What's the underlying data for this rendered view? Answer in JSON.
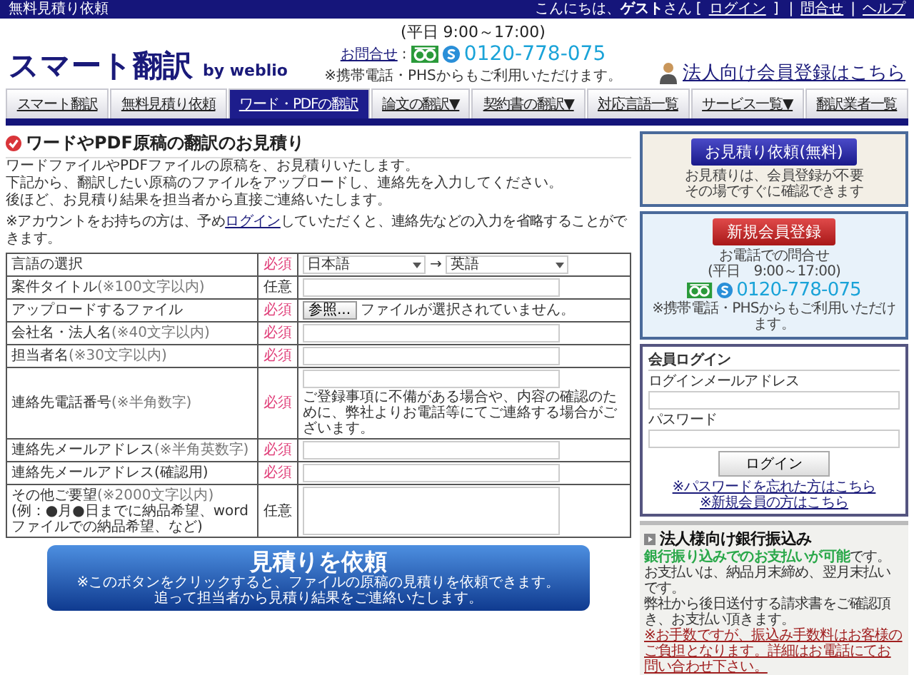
{
  "top_bar": {
    "left_link": "無料見積り依頼",
    "items": [
      {
        "kind": "text",
        "text": "こんにちは、**ゲスト**さん ["
      },
      {
        "kind": "link",
        "text": "ログイン"
      },
      {
        "kind": "text",
        "text": "]"
      },
      {
        "kind": "sep",
        "text": "|"
      },
      {
        "kind": "link",
        "text": "問合せ"
      },
      {
        "kind": "sep",
        "text": "|"
      },
      {
        "kind": "link",
        "text": "ヘルプ"
      }
    ]
  },
  "header": {
    "logo": "スマート翻訳",
    "logo_by": "by weblio",
    "hours": "(平日 9:00～17:00)",
    "contact_label": "お問合せ",
    "colon": ":",
    "phone": "0120-778-075",
    "phone_note": "※携帯電話・PHSからもご利用いただけます。",
    "corporate_link": "法人向け会員登録はこちら"
  },
  "nav": [
    {
      "label": "スマート翻訳",
      "selected": false
    },
    {
      "label": "無料見積り依頼",
      "selected": false
    },
    {
      "label": "ワード・PDFの翻訳",
      "selected": true
    },
    {
      "label": "論文の翻訳▼",
      "selected": false
    },
    {
      "label": "契約書の翻訳▼",
      "selected": false
    },
    {
      "label": "対応言語一覧",
      "selected": false
    },
    {
      "label": "サービス一覧▼",
      "selected": false
    },
    {
      "label": "翻訳業者一覧",
      "selected": false
    }
  ],
  "main": {
    "title": "ワードやPDF原稿の翻訳のお見積り",
    "intro": [
      "ワードファイルやPDFファイルの原稿を、お見積りいたします。",
      "下記から、翻訳したい原稿のファイルをアップロードし、連絡先を入力してください。",
      "後ほど、お見積り結果を担当者から直接ご連絡いたします。"
    ],
    "account_note": {
      "before": "※アカウントをお持ちの方は、予め",
      "link": "ログイン",
      "after": "していただくと、連絡先などの入力を省略することができます。"
    },
    "form_rows": [
      {
        "kind": "select",
        "label": "言語の選択",
        "required": true,
        "requirement": "必須",
        "from": "日本語",
        "arrow": "→",
        "to": "英語"
      },
      {
        "kind": "text",
        "label": "案件タイトル",
        "note": "(※100文字以内)",
        "required": false,
        "requirement": "任意"
      },
      {
        "kind": "file",
        "label": "アップロードするファイル",
        "required": true,
        "requirement": "必須",
        "button": "参照...",
        "status": "ファイルが選択されていません。"
      },
      {
        "kind": "text",
        "label": "会社名・法人名",
        "note": "(※40文字以内)",
        "required": true,
        "requirement": "必須"
      },
      {
        "kind": "text",
        "label": "担当者名",
        "note": "(※30文字以内)",
        "required": true,
        "requirement": "必須"
      },
      {
        "kind": "text",
        "label": "連絡先電話番号",
        "note": "(※半角数字)",
        "required": true,
        "requirement": "必須",
        "hint": "ご登録事項に不備がある場合や、内容の確認のために、弊社よりお電話等にてご連絡する場合がございます。"
      },
      {
        "kind": "text",
        "label": "連絡先メールアドレス",
        "note": "(※半角英数字)",
        "required": true,
        "requirement": "必須"
      },
      {
        "kind": "text",
        "label": "連絡先メールアドレス(確認用)",
        "required": true,
        "requirement": "必須"
      },
      {
        "kind": "textarea",
        "label": "その他ご要望",
        "note": "(※2000文字以内)",
        "example": "(例：●月●日までに納品希望、word ファイルでの納品希望、など)",
        "required": false,
        "requirement": "任意"
      }
    ],
    "submit": {
      "title": "見積りを依頼",
      "notes": [
        "※このボタンをクリックすると、ファイルの原稿の見積りを依頼できます。",
        "追って担当者から見積り結果をご連絡いたします。"
      ]
    }
  },
  "sidebar": {
    "estimate": {
      "button": "お見積り依頼(無料)",
      "lines": [
        "お見積りは、会員登録が不要",
        "その場ですぐに確認できます"
      ]
    },
    "register": {
      "button": "新規会員登録",
      "lines": [
        "お電話での問合せ",
        "(平日　9:00～17:00)"
      ],
      "phone": "0120-778-075",
      "note": "※携帯電話・PHSからもご利用いただけます。"
    },
    "login": {
      "title": "会員ログイン",
      "email_label": "ログインメールアドレス",
      "password_label": "パスワード",
      "button": "ログイン",
      "links": [
        "※パスワードを忘れた方はこちら",
        "※新規会員の方はこちら"
      ]
    },
    "bank": {
      "title": "法人様向け銀行振込み",
      "paragraphs": [
        "**銀行振り込みでのお支払いが可能**です。",
        "お支払いは、納品月末締め、翌月末払いです。",
        "弊社から後日送付する請求書をご確認頂き、お支払い頂きます。"
      ],
      "note": "※お手数ですが、振込み手数料はお客様のご負担となります。詳細はお電話にてお問い合わせ下さい。"
    }
  }
}
